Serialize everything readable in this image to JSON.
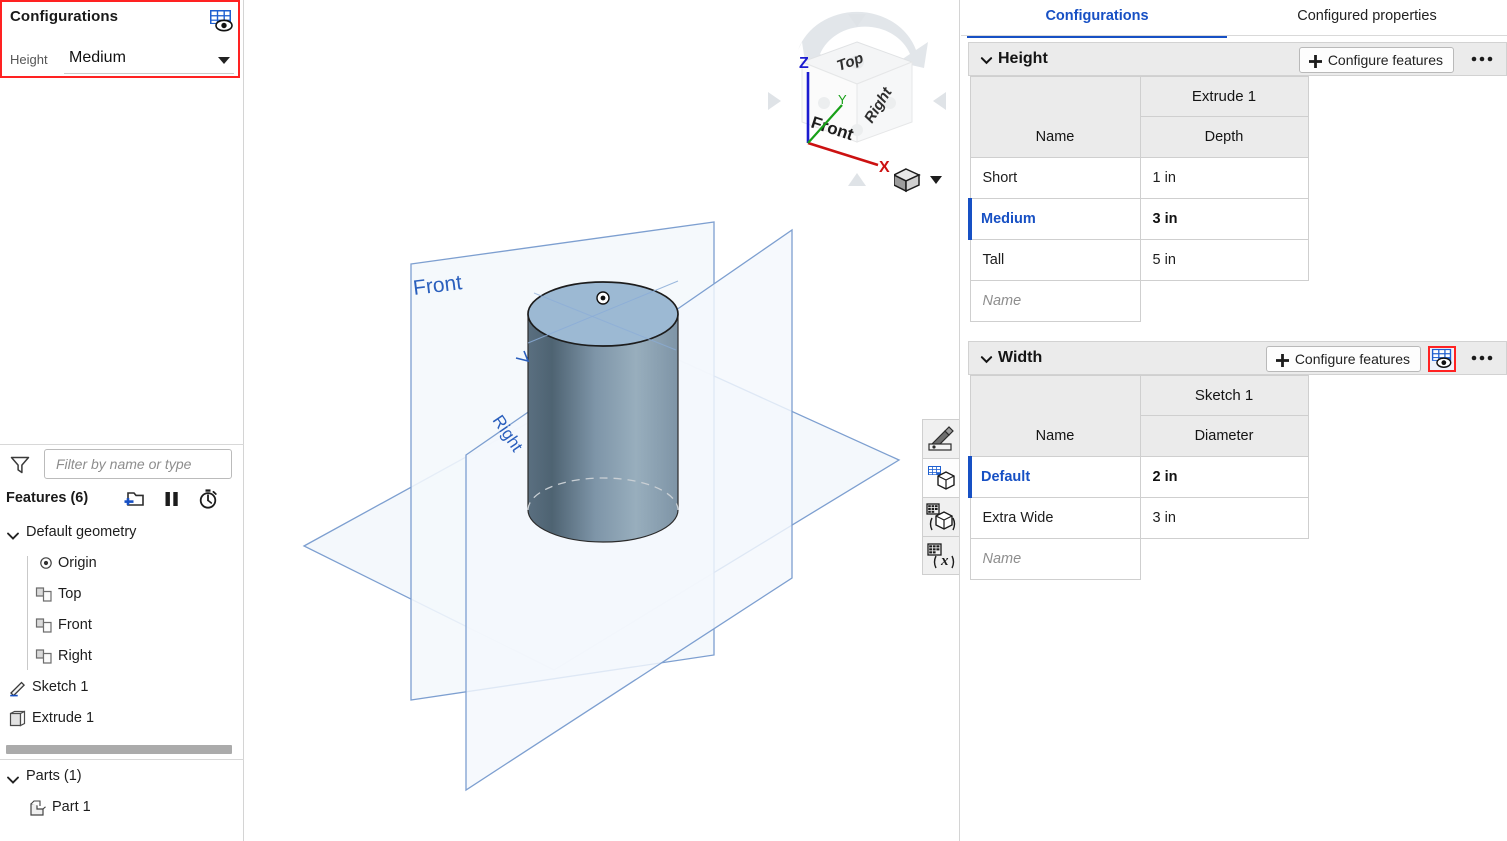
{
  "left_panel": {
    "configurations": {
      "title": "Configurations",
      "grid_eye_icon": "configuration-table-eye-icon",
      "field_label": "Height",
      "field_value": "Medium",
      "caret_icon": "chevron-down-icon"
    },
    "filter": {
      "icon": "funnel-filter-icon",
      "placeholder": "Filter by name or type",
      "value": ""
    },
    "features_header": {
      "label": "Features (6)",
      "tools": [
        {
          "name": "new-folder-icon",
          "title": "New folder"
        },
        {
          "name": "rollback-pause-icon",
          "title": "Rollback"
        },
        {
          "name": "stopwatch-icon",
          "title": "Feature timing"
        }
      ]
    },
    "tree_toggle_icon": "tree-list-toggle-icon",
    "tree": [
      {
        "label": "Default geometry",
        "icon": "chevron-down-icon",
        "indent": 0,
        "type": "group"
      },
      {
        "label": "Origin",
        "icon": "origin-icon",
        "indent": 1,
        "type": "item"
      },
      {
        "label": "Top",
        "icon": "plane-icon",
        "indent": 1,
        "type": "item"
      },
      {
        "label": "Front",
        "icon": "plane-icon",
        "indent": 1,
        "type": "item"
      },
      {
        "label": "Right",
        "icon": "plane-icon",
        "indent": 1,
        "type": "item"
      },
      {
        "label": "Sketch 1",
        "icon": "sketch-pencil-icon",
        "indent": 0,
        "type": "item"
      },
      {
        "label": "Extrude 1",
        "icon": "extrude-icon",
        "indent": 0,
        "type": "item"
      }
    ],
    "parts": {
      "group_label": "Parts (1)",
      "group_icon": "chevron-down-icon",
      "items": [
        {
          "label": "Part 1",
          "icon": "part-body-icon"
        }
      ]
    }
  },
  "viewport": {
    "plane_labels": [
      "Front",
      "Right"
    ],
    "view_cube": {
      "faces": [
        "Top",
        "Front",
        "Right"
      ],
      "axes": [
        {
          "label": "Z",
          "color": "#1b1bd0"
        },
        {
          "label": "Y",
          "color": "#18a018"
        },
        {
          "label": "X",
          "color": "#cc1111"
        }
      ]
    },
    "view_mode_icon": "shaded-cube-icon",
    "view_mode_caret_icon": "chevron-down-icon",
    "toolbar": [
      {
        "name": "appearance-render-icon",
        "title": "Appearance"
      },
      {
        "name": "configuration-cube-icon",
        "title": "Configuration panel"
      },
      {
        "name": "configuration-variants-icon",
        "title": "Configuration variants"
      },
      {
        "name": "configuration-variable-icon",
        "title": "Configuration variable"
      }
    ],
    "colors": {
      "part_top": "#9cb9d3",
      "part_side_dark": "#4f6373",
      "plane_stroke": "#6a8fc4",
      "plane_fill": "#f2f6fb"
    }
  },
  "right_panel": {
    "tabs": [
      {
        "label": "Configurations",
        "active": true
      },
      {
        "label": "Configured properties",
        "active": false
      }
    ],
    "sections": [
      {
        "name": "Height",
        "collapse_icon": "chevron-down-icon",
        "configure_button": "Configure features",
        "plus_icon": "plus-icon",
        "eye_icon": "configuration-table-eye-icon",
        "eye_highlighted": false,
        "overflow_icon": "ellipsis-icon",
        "feature_header": "Extrude 1",
        "name_header": "Name",
        "value_header": "Depth",
        "new_row_placeholder": "Name",
        "rows": [
          {
            "name": "Short",
            "value": "1 in",
            "active": false
          },
          {
            "name": "Medium",
            "value": "3 in",
            "active": true
          },
          {
            "name": "Tall",
            "value": "5 in",
            "active": false
          }
        ]
      },
      {
        "name": "Width",
        "collapse_icon": "chevron-down-icon",
        "configure_button": "Configure features",
        "plus_icon": "plus-icon",
        "eye_icon": "configuration-table-eye-icon",
        "eye_highlighted": true,
        "overflow_icon": "ellipsis-icon",
        "feature_header": "Sketch 1",
        "name_header": "Name",
        "value_header": "Diameter",
        "new_row_placeholder": "Name",
        "rows": [
          {
            "name": "Default",
            "value": "2 in",
            "active": true
          },
          {
            "name": "Extra Wide",
            "value": "3 in",
            "active": false
          }
        ]
      }
    ]
  },
  "theme": {
    "accent_blue": "#1750c4",
    "highlight_red": "#ff2222",
    "header_gray": "#ebebeb",
    "border_gray": "#cfcfcf"
  }
}
